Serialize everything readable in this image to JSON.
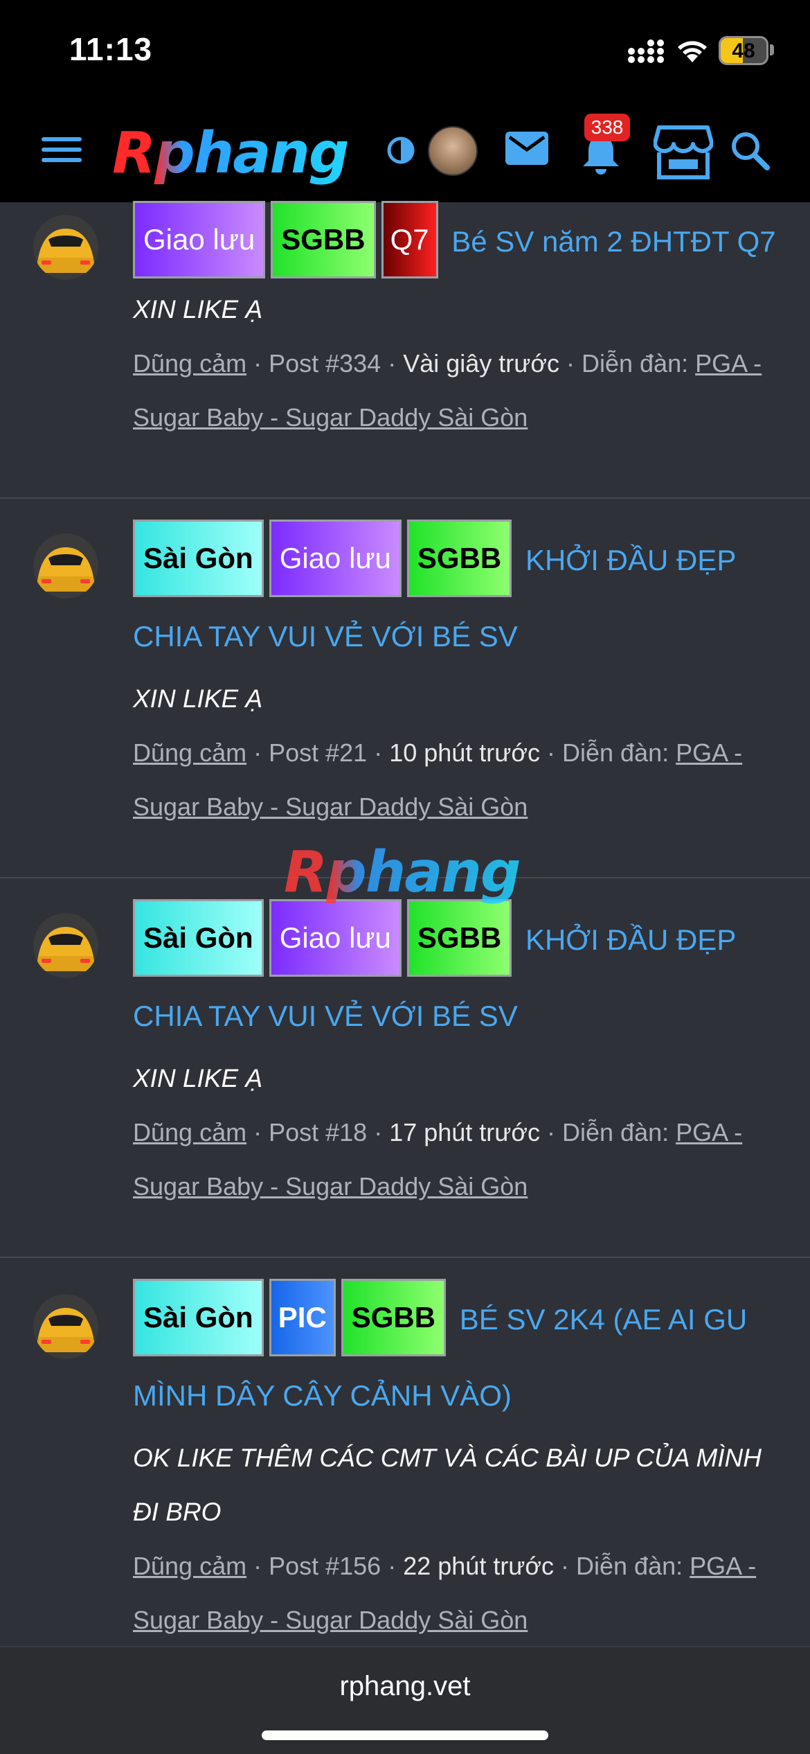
{
  "status_bar": {
    "time": "11:13",
    "battery_level": "48",
    "battery_fraction": 0.48,
    "icons": [
      "signal-icon",
      "wifi-icon",
      "battery-icon"
    ]
  },
  "header": {
    "logo": "Rphang",
    "notification_count": "338",
    "icons": [
      "menu-icon",
      "theme-toggle-icon",
      "avatar",
      "mail-icon",
      "bell-icon",
      "store-icon",
      "search-icon"
    ],
    "icon_color": "#4aa8f0"
  },
  "posts": [
    {
      "tags": [
        "Giao lưu",
        "SGBB",
        "Q7"
      ],
      "title": "Bé SV năm 2 ĐHTĐT Q7",
      "snippet": "XIN LIKE Ạ",
      "author": "Dũng cảm",
      "post_no": "Post #334",
      "time": "Vài giây trước",
      "forum_label": "Diễn đàn:",
      "forum": "PGA - Sugar Baby - Sugar Daddy Sài Gòn"
    },
    {
      "tags": [
        "Sài Gòn",
        "Giao lưu",
        "SGBB"
      ],
      "title": "KHỞI ĐẦU ĐẸP CHIA TAY VUI VẺ VỚI BÉ SV",
      "snippet": "XIN LIKE Ạ",
      "author": "Dũng cảm",
      "post_no": "Post #21",
      "time": "10 phút trước",
      "forum_label": "Diễn đàn:",
      "forum": "PGA - Sugar Baby - Sugar Daddy Sài Gòn"
    },
    {
      "tags": [
        "Sài Gòn",
        "Giao lưu",
        "SGBB"
      ],
      "title": "KHỞI ĐẦU ĐẸP CHIA TAY VUI VẺ VỚI BÉ SV",
      "snippet": "XIN LIKE Ạ",
      "author": "Dũng cảm",
      "post_no": "Post #18",
      "time": "17 phút trước",
      "forum_label": "Diễn đàn:",
      "forum": "PGA - Sugar Baby - Sugar Daddy Sài Gòn"
    },
    {
      "tags": [
        "Sài Gòn",
        "PIC",
        "SGBB"
      ],
      "title": "BÉ SV 2K4 (AE AI GU MÌNH DÂY CÂY CẢNH VÀO)",
      "snippet": "OK LIKE THÊM CÁC CMT VÀ CÁC BÀI UP CỦA MÌNH ĐI BRO",
      "author": "Dũng cảm",
      "post_no": "Post #156",
      "time": "22 phút trước",
      "forum_label": "Diễn đàn:",
      "forum": "PGA - Sugar Baby - Sugar Daddy Sài Gòn"
    }
  ],
  "watermark": "Rphang",
  "browser": {
    "url": "rphang.vet"
  }
}
